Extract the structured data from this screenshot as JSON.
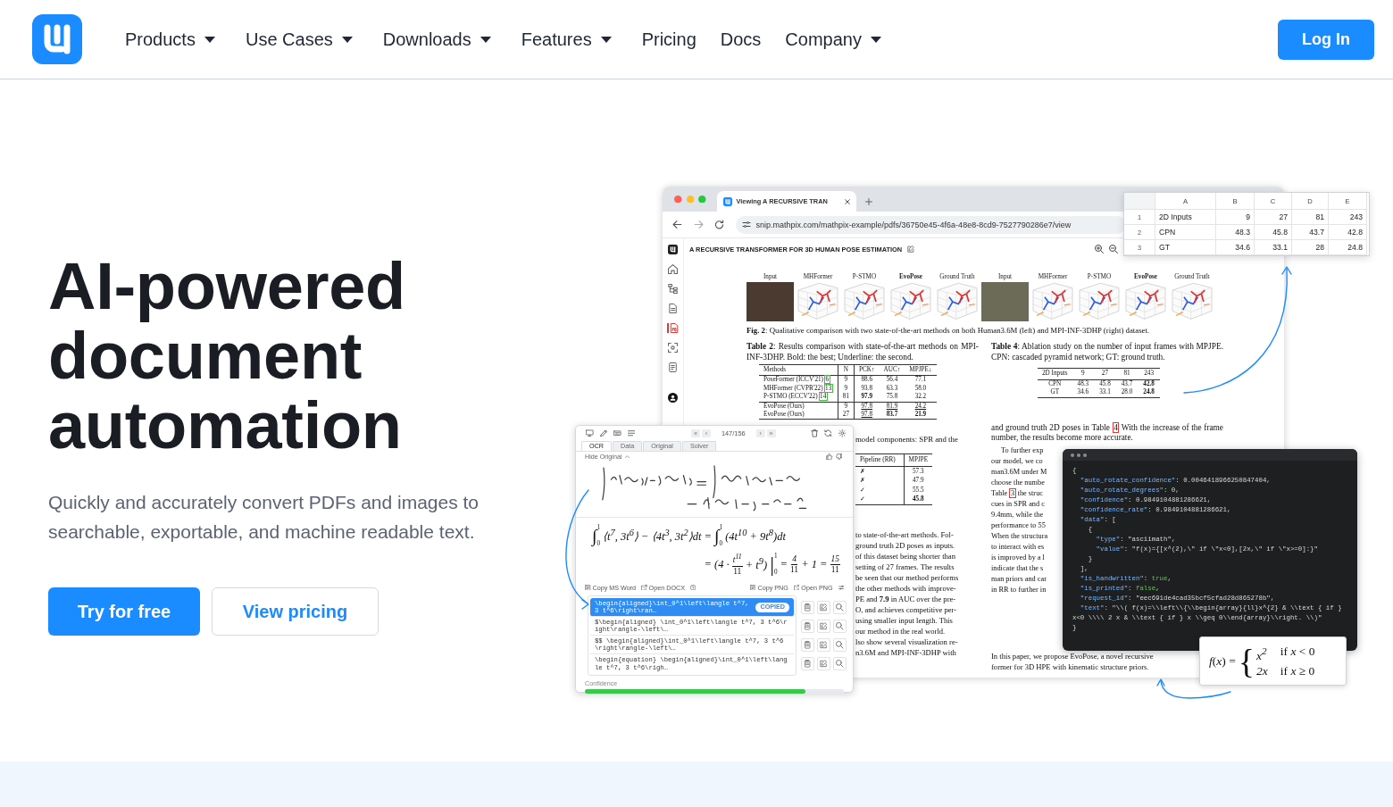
{
  "header": {
    "nav": [
      {
        "label": "Products",
        "dropdown": true
      },
      {
        "label": "Use Cases",
        "dropdown": true
      },
      {
        "label": "Downloads",
        "dropdown": true
      },
      {
        "label": "Features",
        "dropdown": true
      },
      {
        "label": "Pricing",
        "dropdown": false
      },
      {
        "label": "Docs",
        "dropdown": false
      },
      {
        "label": "Company",
        "dropdown": true
      }
    ],
    "login": "Log In"
  },
  "hero": {
    "title": "AI-powered document automation",
    "subtitle": "Quickly and accurately convert PDFs and images to searchable, exportable, and machine readable text.",
    "buttons": [
      {
        "label": "Try for free",
        "kind": "primary"
      },
      {
        "label": "View pricing",
        "kind": "secondary"
      }
    ]
  },
  "illustration": {
    "browser": {
      "tab_title": "Viewing A RECURSIVE TRAN",
      "url": "snip.mathpix.com/mathpix-example/pdfs/36750e45-4f6a-48e8-8cd9-7527790286e7/view",
      "doc_title": "A RECURSIVE TRANSFORMER FOR 3D HUMAN POSE ESTIMATION",
      "sidebar": [
        {
          "kind": "logo",
          "selected": false
        },
        {
          "kind": "home",
          "selected": false
        },
        {
          "kind": "tree",
          "selected": false
        },
        {
          "kind": "document",
          "selected": false
        },
        {
          "kind": "pdf",
          "selected": true
        },
        {
          "kind": "scan",
          "selected": false
        },
        {
          "kind": "file",
          "selected": false
        },
        {
          "kind": "avatar",
          "selected": false
        }
      ],
      "paper": {
        "figure": {
          "panels": [
            {
              "label": "Input",
              "kind": "photo",
              "highlight": false
            },
            {
              "label": "MHFormer",
              "kind": "plot",
              "highlight": false
            },
            {
              "label": "P-STMO",
              "kind": "plot",
              "highlight": false
            },
            {
              "label": "EvoPose",
              "kind": "plot",
              "highlight": true
            },
            {
              "label": "Ground Truth",
              "kind": "plot",
              "highlight": false
            },
            {
              "label": "Input",
              "kind": "photo",
              "highlight": false
            },
            {
              "label": "MHFormer",
              "kind": "plot",
              "highlight": false
            },
            {
              "label": "P-STMO",
              "kind": "plot",
              "highlight": false
            },
            {
              "label": "EvoPose",
              "kind": "plot",
              "highlight": true
            },
            {
              "label": "Ground Truth",
              "kind": "plot",
              "highlight": false
            }
          ],
          "caption": "**Fig. 2**: Qualitative comparison with two state-of-the-art methods on both Human3.6M (left) and MPI-INF-3DHP (right) dataset."
        },
        "table_2": {
          "caption": "**Table 2**: Results comparison with state-of-the-art methods on MPI-INF-3DHP. Bold: the best; Underline: the second.",
          "columns": [
            "Methods",
            "N",
            "PCK↑",
            "AUC↑",
            "MPJPE↓"
          ],
          "row_groups": [
            [
              {
                "method": "PoseFormer (ICCV'21)",
                "ref": "6",
                "cells": [
                  "9",
                  "88.6",
                  "56.4",
                  "77.1"
                ],
                "bold": [
                  false,
                  false,
                  false,
                  false
                ],
                "underlined": [
                  false,
                  false,
                  false,
                  false
                ]
              },
              {
                "method": "MHFormer (CVPR'22)",
                "ref": "13",
                "cells": [
                  "9",
                  "93.8",
                  "63.3",
                  "58.0"
                ],
                "bold": [
                  false,
                  false,
                  false,
                  false
                ],
                "underlined": [
                  false,
                  false,
                  false,
                  false
                ]
              },
              {
                "method": "P-STMO (ECCV'22)",
                "ref": "14",
                "cells": [
                  "81",
                  "97.9",
                  "75.8",
                  "32.2"
                ],
                "bold": [
                  false,
                  true,
                  false,
                  false
                ],
                "underlined": [
                  false,
                  false,
                  false,
                  false
                ]
              }
            ],
            [
              {
                "method": "EvoPose (Ours)",
                "cells": [
                  "9",
                  "97.8",
                  "81.9",
                  "24.2"
                ],
                "bold": [
                  false,
                  false,
                  false,
                  false
                ],
                "underlined": [
                  false,
                  true,
                  true,
                  true
                ]
              },
              {
                "method": "EvoPose (Ours)",
                "cells": [
                  "27",
                  "97.8",
                  "83.7",
                  "21.9"
                ],
                "bold": [
                  false,
                  false,
                  true,
                  true
                ],
                "underlined": [
                  false,
                  true,
                  false,
                  false
                ]
              }
            ]
          ]
        },
        "left_column": {
          "intro": "model components: SPR and the",
          "table": {
            "columns": [
              "Pipeline (RR)",
              "MPJPE"
            ],
            "rows": [
              {
                "cells": [
                  "✗",
                  "57.3"
                ],
                "bold": [
                  false,
                  false
                ]
              },
              {
                "cells": [
                  "✗",
                  "47.9"
                ],
                "bold": [
                  false,
                  false
                ]
              },
              {
                "cells": [
                  "✓",
                  "55.5"
                ],
                "bold": [
                  false,
                  false
                ]
              },
              {
                "cells": [
                  "✓",
                  "45.8"
                ],
                "bold": [
                  false,
                  true
                ]
              }
            ]
          },
          "lines": [
            "to state-of-the-art methods. Fol-",
            "ground truth 2D poses as inputs.",
            "of this dataset being shorter than",
            "setting of 27 frames. The results",
            "be seen that our method performs",
            "the other methods with improve-",
            "PE and **7.9** in AUC over the pre-",
            "O, and achieves competitive per-",
            "using smaller input length. This",
            "our method in the real world.",
            "lso show several visualization re-",
            "n3.6M and MPI-INF-3DHP with"
          ]
        },
        "right_column": {
          "table_4": {
            "caption": "**Table 4**: Ablation study on the number of input frames with MPJPE. CPN: cascaded pyramid network; GT: ground truth.",
            "columns": [
              "2D Inputs",
              "9",
              "27",
              "81",
              "243"
            ],
            "rows": [
              {
                "cells": [
                  "CPN",
                  "48.3",
                  "45.8",
                  "43.7",
                  "42.8"
                ],
                "bold": [
                  false,
                  false,
                  false,
                  false,
                  true
                ]
              },
              {
                "cells": [
                  "GT",
                  "34.6",
                  "33.1",
                  "28.0",
                  "24.8"
                ],
                "bold": [
                  false,
                  false,
                  false,
                  false,
                  true
                ]
              }
            ]
          },
          "paragraph": {
            "before": "and ground truth 2D poses in Table ",
            "ref": "4",
            "after": " With the increase of the frame number, the results become more accurate."
          },
          "lines": [
            {
              "text": "To further exp"
            },
            {
              "text": "our model, we co"
            },
            {
              "text": "man3.6M under M"
            },
            {
              "text": "choose the numbe"
            },
            {
              "text": "Table ",
              "ref": "3",
              "after": " the struc"
            },
            {
              "text": "cues in SPR and c"
            },
            {
              "text": "9.4mm, while the"
            },
            {
              "text": "performance to 55"
            },
            {
              "text": "When the structura"
            },
            {
              "text": "to interact with es"
            },
            {
              "text": "is improved by a l"
            },
            {
              "text": "indicate that the s"
            },
            {
              "text": "man priors and car"
            },
            {
              "text": "in RR to further in"
            }
          ],
          "closing_lines": [
            "In this paper, we propose EvoPose, a novel recursive",
            "former for 3D HPE with kinematic structure priors."
          ]
        }
      }
    },
    "spreadsheet": {
      "columns": [
        "A",
        "B",
        "C",
        "D",
        "E"
      ],
      "rows": [
        {
          "number": "1",
          "cells": [
            "2D Inputs",
            "9",
            "27",
            "81",
            "243"
          ]
        },
        {
          "number": "2",
          "cells": [
            "CPN",
            "48.3",
            "45.8",
            "43.7",
            "42.8"
          ]
        },
        {
          "number": "3",
          "cells": [
            "GT",
            "34.6",
            "33.1",
            "28",
            "24.8"
          ]
        }
      ]
    },
    "ocr_panel": {
      "pager": {
        "before": [
          "«",
          "‹"
        ],
        "position": "147/156",
        "after": [
          "›",
          "»"
        ]
      },
      "tabs": [
        {
          "label": "OCR",
          "selected": true
        },
        {
          "label": "Data",
          "selected": false
        },
        {
          "label": "Original",
          "selected": false
        },
        {
          "label": "Solver",
          "selected": false
        }
      ],
      "toggle": "Hide Original",
      "math_lines": [
        [
          {
            "kind": "integral",
            "sign": "∫",
            "upper": "1",
            "lower": "0"
          },
          {
            "kind": "text",
            "text": "⟨t$^{7}$, 3t$^{6}$⟩ − ⟨4t$^{3}$, 3t$^{2}$⟩dt ="
          },
          {
            "kind": "integral",
            "sign": "∫",
            "upper": "1",
            "lower": "0"
          },
          {
            "kind": "text",
            "text": "(4t$^{10}$ + 9t$^{8}$)dt"
          }
        ],
        [
          {
            "kind": "text",
            "text": "= (4 ·"
          },
          {
            "kind": "fraction",
            "num": "t$^{11}$",
            "den": "11"
          },
          {
            "kind": "text",
            "text": "+ t$^{9}$)"
          },
          {
            "kind": "evaluation",
            "sign": "|",
            "upper": "1",
            "lower": "0"
          },
          {
            "kind": "text",
            "text": "="
          },
          {
            "kind": "fraction",
            "num": "4",
            "den": "11"
          },
          {
            "kind": "text",
            "text": "+ 1 ="
          },
          {
            "kind": "fraction",
            "num": "15",
            "den": "11"
          }
        ]
      ],
      "actions_left": [
        {
          "label": "Copy MS Word",
          "kind": "copy"
        },
        {
          "label": "Open DOCX",
          "kind": "open"
        }
      ],
      "actions_right": [
        {
          "label": "Copy PNG",
          "kind": "copy"
        },
        {
          "label": "Open PNG",
          "kind": "open"
        }
      ],
      "results": [
        {
          "text": "\\begin{aligned}\\int_0^1\\left\\langle t^7, 3 t^6\\right\\ran…",
          "selected": true,
          "badge": "COPIED"
        },
        {
          "text": "$\\begin{aligned} \\int_0^1\\left\\langle t^7, 3 t^6\\right\\rangle-\\left\\…",
          "selected": false
        },
        {
          "text": "$$ \\begin{aligned}\\int_0^1\\left\\langle t^7, 3 t^6\\right\\rangle-\\left\\…",
          "selected": false
        },
        {
          "text": "\\begin{equation} \\begin{aligned}\\int_0^1\\left\\langle t^7, 3 t^6\\righ…",
          "selected": false
        }
      ],
      "confidence": {
        "label": "Confidence",
        "level": 0.85
      }
    },
    "json_view": {
      "lines": [
        {
          "parts": [
            {
              "kind": "plain",
              "text": "{"
            }
          ],
          "children": [
            {
              "parts": [
                {
                  "kind": "key",
                  "text": "\"auto_rotate_confidence\""
                },
                {
                  "kind": "plain",
                  "text": ": 0.0046418966250847404,"
                }
              ]
            },
            {
              "parts": [
                {
                  "kind": "key",
                  "text": "\"auto_rotate_degrees\""
                },
                {
                  "kind": "plain",
                  "text": ": 0,"
                }
              ]
            },
            {
              "parts": [
                {
                  "kind": "key",
                  "text": "\"confidence\""
                },
                {
                  "kind": "plain",
                  "text": ": 0.9849104881286621,"
                }
              ]
            },
            {
              "parts": [
                {
                  "kind": "key",
                  "text": "\"confidence_rate\""
                },
                {
                  "kind": "plain",
                  "text": ": 0.9849104881286621,"
                }
              ]
            },
            {
              "parts": [
                {
                  "kind": "key",
                  "text": "\"data\""
                },
                {
                  "kind": "plain",
                  "text": ": ["
                }
              ],
              "children": [
                {
                  "parts": [
                    {
                      "kind": "plain",
                      "text": "{"
                    }
                  ],
                  "children": [
                    {
                      "parts": [
                        {
                          "kind": "key",
                          "text": "\"type\""
                        },
                        {
                          "kind": "plain",
                          "text": ": \"asciimath\","
                        }
                      ]
                    },
                    {
                      "parts": [
                        {
                          "kind": "key",
                          "text": "\"value\""
                        },
                        {
                          "kind": "plain",
                          "text": ": \"f(x)={[x^(2),\\\" if \\\"x<0],[2x,\\\" if \\\"x>=0]:}\""
                        }
                      ]
                    }
                  ]
                },
                {
                  "parts": [
                    {
                      "kind": "plain",
                      "text": "}"
                    }
                  ]
                }
              ]
            },
            {
              "parts": [
                {
                  "kind": "plain",
                  "text": "],"
                }
              ]
            },
            {
              "parts": [
                {
                  "kind": "key",
                  "text": "\"is_handwritten\""
                },
                {
                  "kind": "plain",
                  "text": ": "
                },
                {
                  "kind": "bool",
                  "text": "true"
                },
                {
                  "kind": "plain",
                  "text": ","
                }
              ]
            },
            {
              "parts": [
                {
                  "kind": "key",
                  "text": "\"is_printed\""
                },
                {
                  "kind": "plain",
                  "text": ": "
                },
                {
                  "kind": "bool",
                  "text": "false"
                },
                {
                  "kind": "plain",
                  "text": ","
                }
              ]
            },
            {
              "parts": [
                {
                  "kind": "key",
                  "text": "\"request_id\""
                },
                {
                  "kind": "plain",
                  "text": ": \"eec691de4cad35bcf5cfad28d865278b\","
                }
              ]
            },
            {
              "parts": [
                {
                  "kind": "key",
                  "text": "\"text\""
                },
                {
                  "kind": "plain",
                  "text": ": \"\\\\( f(x)=\\\\left\\\\{\\\\begin{array}{ll}x^{2} & \\\\text { if } x<0 \\\\\\\\ 2 x & \\\\text { if } x \\\\geq 0\\\\end{array}\\\\right. \\\\)\""
                }
              ]
            }
          ]
        },
        {
          "parts": [
            {
              "kind": "plain",
              "text": "}"
            }
          ]
        }
      ]
    },
    "formula": {
      "lhs": "*f*(*x*) =",
      "brace": "{",
      "cases": [
        {
          "expr": "x$^{2}$",
          "cond": "if *x* < 0"
        },
        {
          "expr": "2x",
          "cond": "if *x* ≥ 0"
        }
      ]
    }
  }
}
